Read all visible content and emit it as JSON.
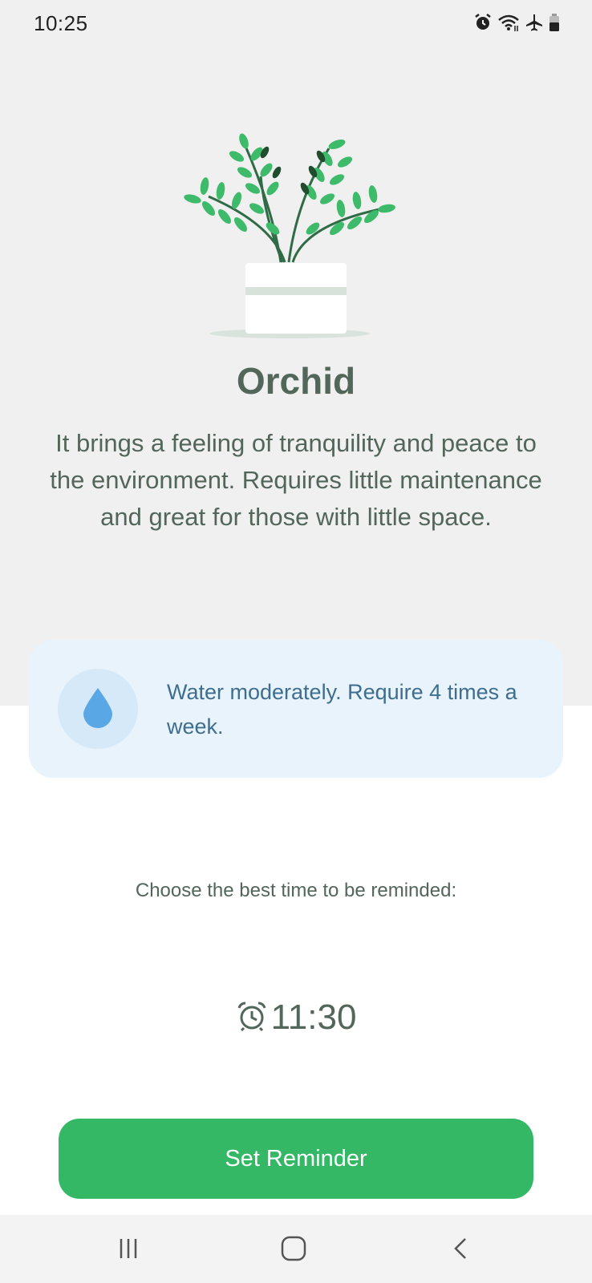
{
  "status_bar": {
    "time": "10:25",
    "icons": [
      "alarm-icon",
      "wifi-icon",
      "airplane-icon",
      "battery-icon"
    ]
  },
  "plant": {
    "name": "Orchid",
    "description": "It brings a feeling of tranquility and peace to the environment. Requires little maintenance and great for those with little space."
  },
  "water": {
    "icon": "water-drop-icon",
    "text": "Water moderately. Require 4 times a week."
  },
  "reminder": {
    "prompt": "Choose the best time to be reminded:",
    "time": "11:30",
    "icon": "alarm-clock-icon",
    "button_label": "Set Reminder"
  },
  "nav": {
    "items": [
      "recents-icon",
      "home-icon",
      "back-icon"
    ]
  },
  "colors": {
    "accent": "#34B866",
    "text": "#52665A",
    "water_card_bg": "#E8F3FB",
    "water_text": "#3E6E8F",
    "drop": "#5AA7E6"
  }
}
